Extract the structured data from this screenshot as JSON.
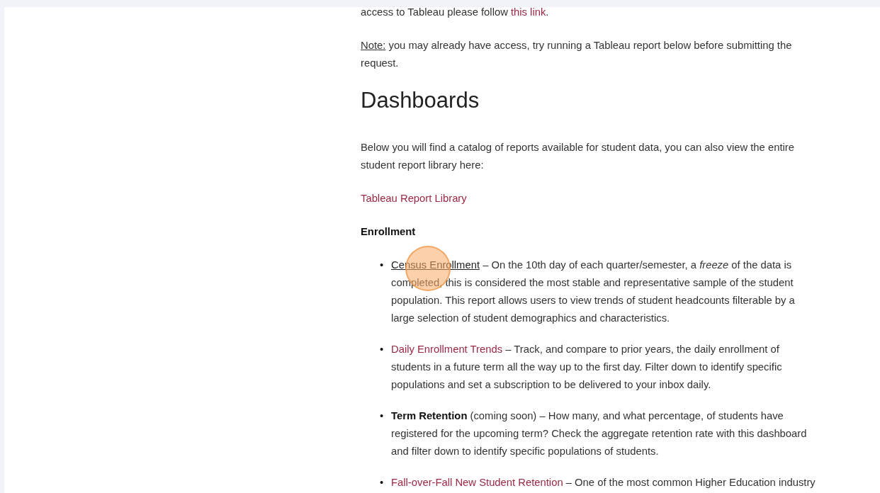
{
  "intro": {
    "text": "access to Tableau please follow ",
    "link": "this link",
    "end": "."
  },
  "note": {
    "label": "Note:",
    "text": " you may already have access, try running a Tableau report below before submitting the request."
  },
  "heading": "Dashboards",
  "catalog_text": "Below you will find a catalog of reports available for student data, you can also view the entire student report library here:",
  "library_link": "Tableau Report Library",
  "section_title": "Enrollment",
  "reports": [
    {
      "marker": "•",
      "kind": "link",
      "name": "Census Enrollment",
      "hovered": true,
      "clicked": true,
      "description": " – On the 10th day of each quarter/semester, a *freeze* of the data is completed, this is considered the most stable and representative sample of the student population. This report allows users to view trends of student headcounts filterable by a large selection of student demographics and characteristics."
    },
    {
      "marker": "•",
      "kind": "link",
      "name": "Daily Enrollment Trends",
      "hovered": false,
      "clicked": false,
      "description": " – Track, and compare to prior years, the daily enrollment of students in a future term all the way up to the first day. Filter down to identify specific populations and set a subscription to be delivered to your inbox daily."
    },
    {
      "marker": "•",
      "kind": "bold",
      "name": "Term Retention",
      "status": "(coming soon)",
      "description": " – How many, and what percentage, of students have registered for the upcoming term? Check the aggregate retention rate with this dashboard and filter down to identify specific populations of students."
    },
    {
      "marker": "•",
      "kind": "link",
      "name": "Fall-over-Fall New Student Retention",
      "hovered": false,
      "clicked": false,
      "description": " – One of the most common Higher Education industry"
    }
  ]
}
